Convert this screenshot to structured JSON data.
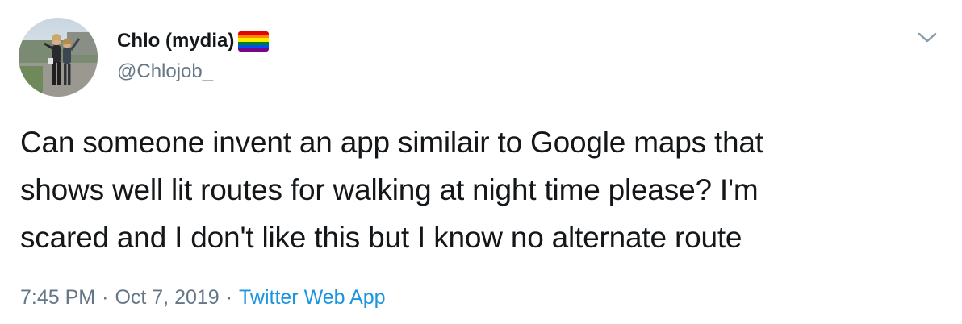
{
  "tweet": {
    "author": {
      "display_name": "Chlo (mydia)",
      "handle": "@Chlojob_",
      "flag_icon": "rainbow-flag-icon",
      "flag_colors": [
        "#e40303",
        "#ff8c00",
        "#ffed00",
        "#008026",
        "#004dff",
        "#750787"
      ]
    },
    "menu_icon": "chevron-down-icon",
    "text_lines": [
      "Can someone invent an app similair to Google maps that",
      "shows well lit routes for walking at night time please?  I'm",
      "scared and I don't like this but I know no alternate route"
    ],
    "time": "7:45 PM",
    "separator": "·",
    "date": "Oct 7, 2019",
    "source": "Twitter Web App"
  },
  "colors": {
    "text_primary": "#14171a",
    "text_secondary": "#657786",
    "link": "#1b95e0",
    "background": "#ffffff"
  }
}
